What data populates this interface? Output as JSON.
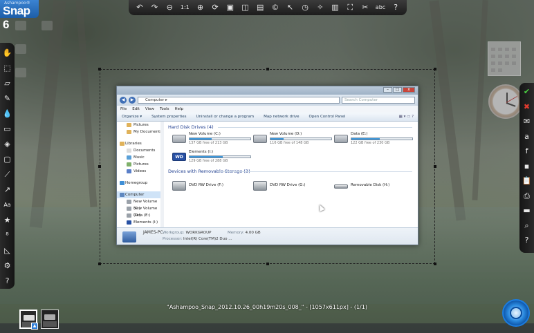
{
  "app": {
    "brand": "Ashampoo®",
    "name": "Snap 6"
  },
  "top_toolbar": [
    {
      "name": "undo-icon",
      "glyph": "↶"
    },
    {
      "name": "redo-icon",
      "glyph": "↷"
    },
    {
      "name": "zoom-out-icon",
      "glyph": "⊖"
    },
    {
      "name": "zoom-reset-icon",
      "glyph": "1:1"
    },
    {
      "name": "zoom-in-icon",
      "glyph": "⊕"
    },
    {
      "name": "rotate-icon",
      "glyph": "⟳"
    },
    {
      "name": "image-icon",
      "glyph": "▣"
    },
    {
      "name": "frame-icon",
      "glyph": "◫"
    },
    {
      "name": "layer-icon",
      "glyph": "▤"
    },
    {
      "name": "copyright-icon",
      "glyph": "©"
    },
    {
      "name": "pointer-icon",
      "glyph": "↖"
    },
    {
      "name": "clock-icon",
      "glyph": "◷"
    },
    {
      "name": "magic-wand-icon",
      "glyph": "✧"
    },
    {
      "name": "bucket-icon",
      "glyph": "▥"
    },
    {
      "name": "fullscreen-icon",
      "glyph": "⛶"
    },
    {
      "name": "tools-icon",
      "glyph": "✂"
    },
    {
      "name": "spellcheck-icon",
      "glyph": "abc"
    },
    {
      "name": "help-icon",
      "glyph": "?"
    }
  ],
  "left_toolbar": [
    {
      "name": "hand-icon",
      "glyph": "✋"
    },
    {
      "name": "select-icon",
      "glyph": "⬚"
    },
    {
      "name": "eraser-icon",
      "glyph": "▱"
    },
    {
      "name": "pencil-icon",
      "glyph": "✎"
    },
    {
      "name": "drop-icon",
      "glyph": "💧"
    },
    {
      "name": "crop-icon",
      "glyph": "▭"
    },
    {
      "name": "fill-icon",
      "glyph": "◈"
    },
    {
      "name": "rectangle-icon",
      "glyph": "▢"
    },
    {
      "name": "brush-icon",
      "glyph": "⟋"
    },
    {
      "name": "arrow-icon",
      "glyph": "↗"
    },
    {
      "name": "text-icon",
      "glyph": "Aa"
    },
    {
      "name": "stamp-icon",
      "glyph": "★"
    },
    {
      "name": "counter-icon",
      "glyph": "⁸"
    },
    {
      "name": "ruler-icon",
      "glyph": "◺"
    },
    {
      "name": "settings-icon",
      "glyph": "⚙"
    },
    {
      "name": "help-icon",
      "glyph": "?"
    }
  ],
  "right_toolbar": [
    {
      "name": "confirm-icon",
      "glyph": "✔"
    },
    {
      "name": "discard-icon",
      "glyph": "✖"
    },
    {
      "name": "email-icon",
      "glyph": "✉"
    },
    {
      "name": "amazon-icon",
      "glyph": "a"
    },
    {
      "name": "facebook-icon",
      "glyph": "f"
    },
    {
      "name": "save-icon",
      "glyph": "▪"
    },
    {
      "name": "clipboard-icon",
      "glyph": "📋"
    },
    {
      "name": "print-icon",
      "glyph": "⎙"
    },
    {
      "name": "folder-icon",
      "glyph": "▬"
    },
    {
      "name": "search-folder-icon",
      "glyph": "⌕"
    },
    {
      "name": "help-icon",
      "glyph": "?"
    }
  ],
  "caption": "\"Ashampoo_Snap_2012.10.26_00h19m20s_008_\" - [1057x611px] - (1/1)",
  "explorer": {
    "address": "Computer ▸",
    "search_placeholder": "Search Computer",
    "menu": [
      "File",
      "Edit",
      "View",
      "Tools",
      "Help"
    ],
    "commands": [
      "Organize ▾",
      "System properties",
      "Uninstall or change a program",
      "Map network drive",
      "Open Control Panel"
    ],
    "nav": [
      {
        "label": "Pictures",
        "type": "sub",
        "color": "#e0b25a"
      },
      {
        "label": "My Documents",
        "type": "sub",
        "color": "#e0b25a"
      },
      {
        "label": "",
        "type": "gap"
      },
      {
        "label": "Libraries",
        "type": "top",
        "color": "#e0b25a"
      },
      {
        "label": "Documents",
        "type": "sub",
        "color": "#dcdcdc"
      },
      {
        "label": "Music",
        "type": "sub",
        "color": "#5aa0d8"
      },
      {
        "label": "Pictures",
        "type": "sub",
        "color": "#7fb06a"
      },
      {
        "label": "Videos",
        "type": "sub",
        "color": "#5a7fc8"
      },
      {
        "label": "",
        "type": "gap"
      },
      {
        "label": "Homegroup",
        "type": "top",
        "color": "#3f8fd6"
      },
      {
        "label": "",
        "type": "gap"
      },
      {
        "label": "Computer",
        "type": "top sel",
        "color": "#5f88c0"
      },
      {
        "label": "New Volume (C:)",
        "type": "sub",
        "color": "#9aa1a9"
      },
      {
        "label": "New Volume (D:)",
        "type": "sub",
        "color": "#9aa1a9"
      },
      {
        "label": "Data (E:)",
        "type": "sub",
        "color": "#9aa1a9"
      },
      {
        "label": "Elements (I:)",
        "type": "sub",
        "color": "#2851a4"
      }
    ],
    "hdd_header": "Hard Disk Drives (4)",
    "drives": [
      {
        "name": "New Volume (C:)",
        "free": "137 GB free of 213 GB",
        "used_fraction": 0.36,
        "icon": "windows-drive-icon"
      },
      {
        "name": "New Volume (D:)",
        "free": "116 GB free of 148 GB",
        "used_fraction": 0.22,
        "icon": "hard-drive-icon"
      },
      {
        "name": "Data (E:)",
        "free": "122 GB free of 230 GB",
        "used_fraction": 0.47,
        "icon": "hard-drive-icon"
      },
      {
        "name": "Elements (I:)",
        "free": "129 GB free of 288 GB",
        "used_fraction": 0.55,
        "icon": "wd-drive-icon",
        "icon_text": "WD"
      }
    ],
    "removable_header": "Devices with Removable Storage (3)",
    "removable": [
      {
        "name": "DVD RW Drive (F:)"
      },
      {
        "name": "DVD RW Drive (G:)"
      },
      {
        "name": "Removable Disk (H:)"
      }
    ],
    "details": {
      "pc_name": "JAMES-PC",
      "workgroup_label": "Workgroup:",
      "workgroup": "WORKGROUP",
      "memory_label": "Memory:",
      "memory": "4.00 GB",
      "processor_label": "Processor:",
      "processor": "Intel(R) Core(TM)2 Duo ..."
    }
  }
}
